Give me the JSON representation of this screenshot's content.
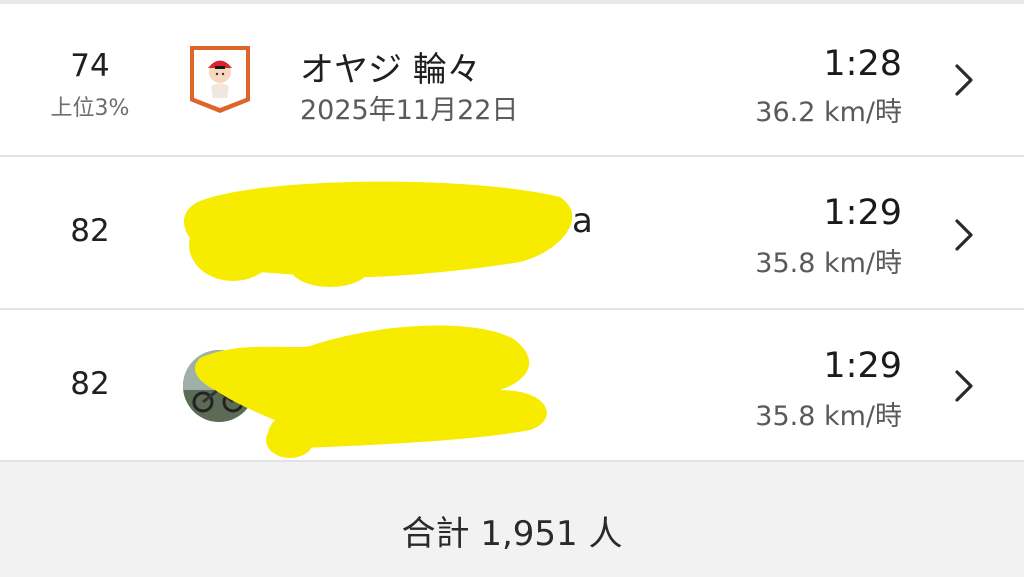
{
  "leaderboard": {
    "entries": [
      {
        "rank": "74",
        "percentile": "上位3%",
        "name": "オヤジ 輪々",
        "date": "2025年11月22日",
        "time": "1:28",
        "speed": "36.2 km/時",
        "avatar_icon": "cartoon-cyclist-badge-icon"
      },
      {
        "rank": "82",
        "time": "1:29",
        "speed": "35.8 km/時",
        "name_visible_fragment": "a"
      },
      {
        "rank": "82",
        "time": "1:29",
        "speed": "35.8 km/時",
        "avatar_icon": "cyclist-photo-avatar-icon"
      }
    ],
    "footer": {
      "total": "合計 1,951 人"
    }
  },
  "colors": {
    "badge_orange": "#e0642a",
    "redaction_yellow": "#f7ec00",
    "divider": "#e2e2e2",
    "footer_bg": "#f2f2f2"
  }
}
